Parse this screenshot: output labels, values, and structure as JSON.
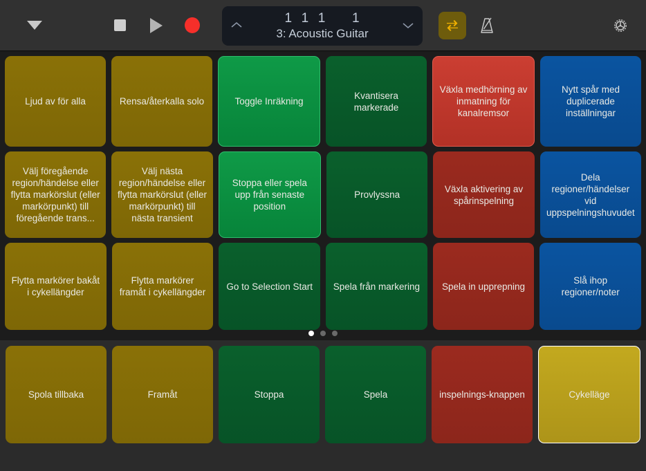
{
  "toolbar": {
    "menu_icon": "triangle-down-icon",
    "stop_label": "Stoppa",
    "play_label": "Spela",
    "record_label": "Spela in",
    "cycle_icon": "cycle-loop-icon",
    "metronome_icon": "metronome-icon",
    "settings_icon": "gear-icon",
    "cycle_active": true,
    "lcd": {
      "position": "1  1  1      1",
      "track": "3: Acoustic Guitar",
      "up_chevron": "chevron-up-icon",
      "down_chevron": "chevron-down-icon"
    }
  },
  "colors": {
    "gold": "#8a7107",
    "gold_selected": "#c3a91f",
    "green_lit": "#0f9a47",
    "green": "#0a602c",
    "red_lit": "#cb3e32",
    "red": "#9b2a1f",
    "blue": "#0a54a0",
    "background": "#1c1c1c",
    "toolbar": "#313131",
    "bottom_bar": "#2b2b2b",
    "lcd": "#161a21",
    "record_red": "#f62f2a",
    "cycle_yellow": "#f0b000"
  },
  "grid": {
    "rows": [
      [
        {
          "label": "Ljud av för alla",
          "color": "c-gold"
        },
        {
          "label": "Rensa/återkalla solo",
          "color": "c-gold"
        },
        {
          "label": "Toggle Inräkning",
          "color": "c-green-lit"
        },
        {
          "label": "Kvantisera markerade",
          "color": "c-green"
        },
        {
          "label": "Växla medhörning av inmatning för kanalremsor",
          "color": "c-red-lit"
        },
        {
          "label": "Nytt spår med duplicerade inställningar",
          "color": "c-blue"
        }
      ],
      [
        {
          "label": "Välj föregående region/händelse eller flytta markörslut (eller markörpunkt) till föregående trans...",
          "color": "c-gold"
        },
        {
          "label": "Välj nästa region/händelse eller flytta markörslut (eller markörpunkt) till nästa transient",
          "color": "c-gold"
        },
        {
          "label": "Stoppa eller spela upp från senaste position",
          "color": "c-green-lit"
        },
        {
          "label": "Provlyssna",
          "color": "c-green"
        },
        {
          "label": "Växla aktivering av spårinspelning",
          "color": "c-red"
        },
        {
          "label": "Dela regioner/händelser vid uppspelningshuvudet",
          "color": "c-blue"
        }
      ],
      [
        {
          "label": "Flytta markörer bakåt i cykellängder",
          "color": "c-gold"
        },
        {
          "label": "Flytta markörer framåt i cykellängder",
          "color": "c-gold"
        },
        {
          "label": "Go to Selection Start",
          "color": "c-green"
        },
        {
          "label": "Spela från markering",
          "color": "c-green"
        },
        {
          "label": "Spela in upprepning",
          "color": "c-red"
        },
        {
          "label": "Slå ihop regioner/noter",
          "color": "c-blue"
        }
      ]
    ],
    "page_dots": {
      "count": 3,
      "active_index": 0
    }
  },
  "bottom": {
    "buttons": [
      {
        "label": "Spola tillbaka",
        "color": "c-gold"
      },
      {
        "label": "Framåt",
        "color": "c-gold"
      },
      {
        "label": "Stoppa",
        "color": "c-green"
      },
      {
        "label": "Spela",
        "color": "c-green"
      },
      {
        "label": "inspelnings-knappen",
        "color": "c-red"
      },
      {
        "label": "Cykelläge",
        "color": "c-gold-sel"
      }
    ]
  }
}
